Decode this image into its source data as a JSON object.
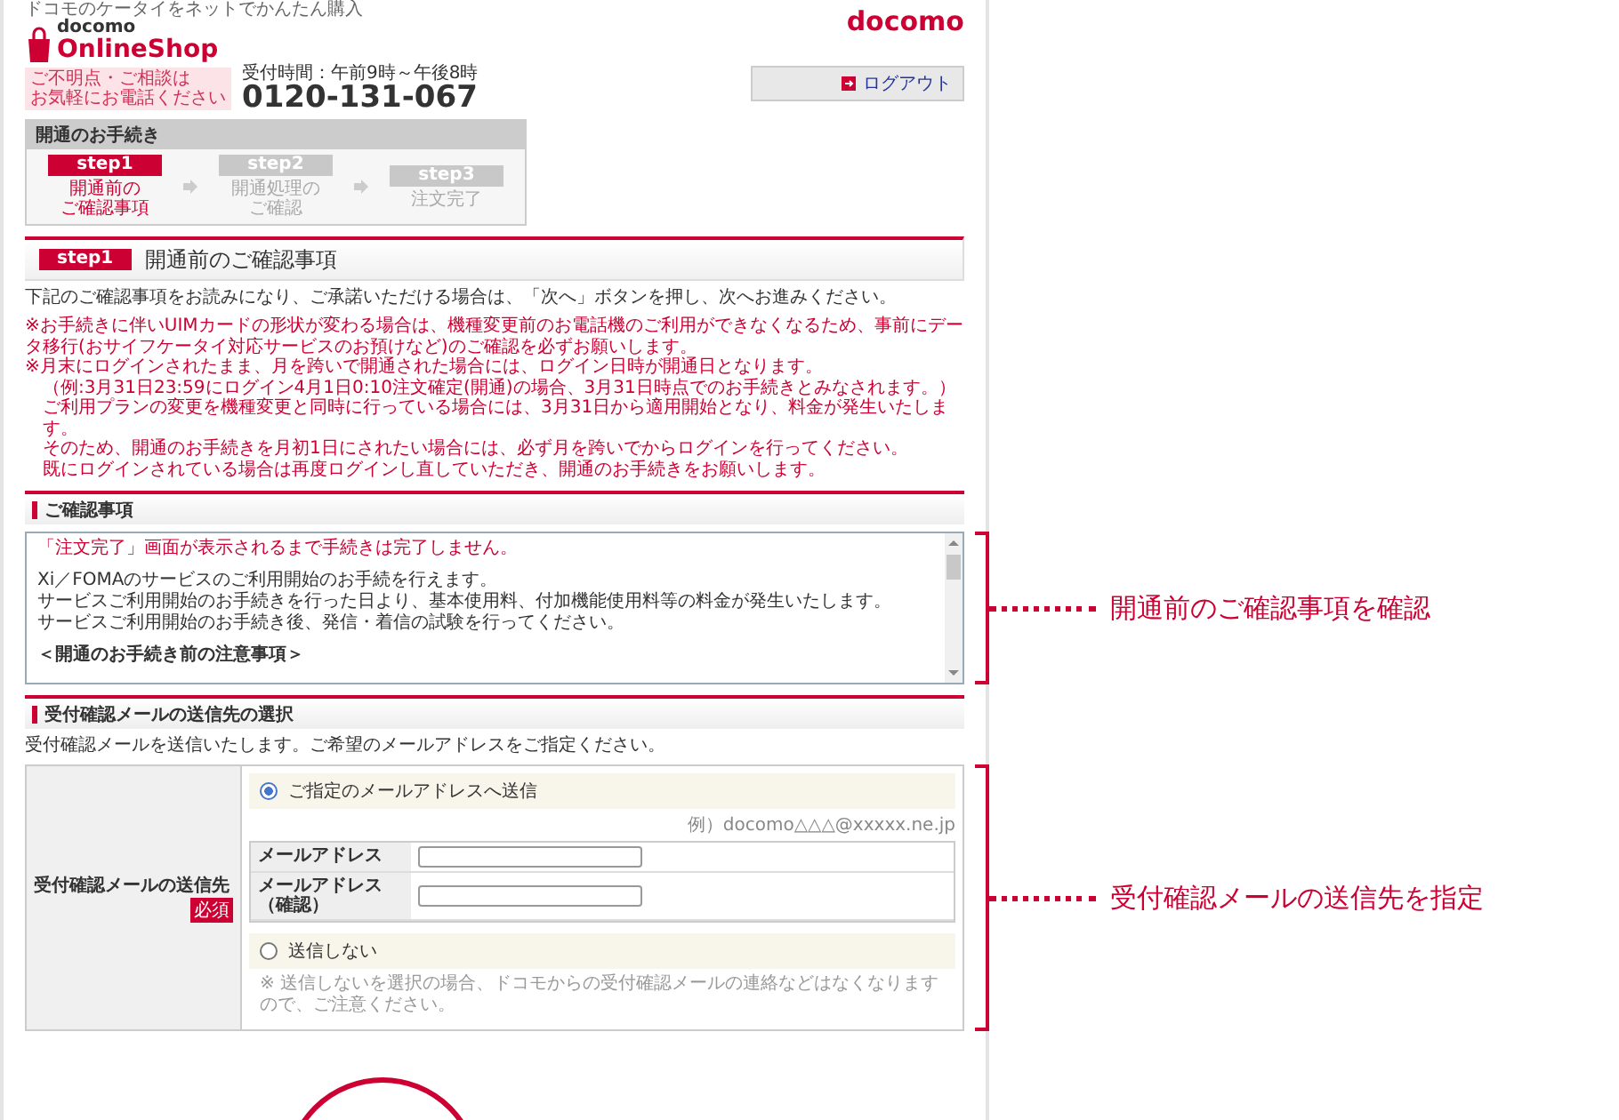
{
  "header": {
    "tagline": "ドコモのケータイをネットでかんたん購入",
    "logo_small": "docomo",
    "logo_text": "OnlineShop",
    "brand": "docomo"
  },
  "contact": {
    "notice": [
      "ご不明点・ご相談は",
      "お気軽にお電話ください"
    ],
    "hours": "受付時間：午前9時～午後8時",
    "phone": "0120-131-067"
  },
  "logout_button": "ログアウト",
  "steps_panel": {
    "title": "開通のお手続き",
    "steps": [
      {
        "label": "step1",
        "text": [
          "開通前の",
          "ご確認事項"
        ],
        "current": true
      },
      {
        "label": "step2",
        "text": [
          "開通処理の",
          "ご確認"
        ],
        "current": false
      },
      {
        "label": "step3",
        "text": [
          "注文完了"
        ],
        "current": false
      }
    ]
  },
  "page_heading": {
    "badge": "step1",
    "title": "開通前のご確認事項"
  },
  "intro": "下記のご確認事項をお読みになり、ご承諾いただける場合は、「次へ」ボタンを押し、次へお進みください。",
  "notes": [
    {
      "kind": "main",
      "text": "※お手続きに伴いUIMカードの形状が変わる場合は、機種変更前のお電話機のご利用ができなくなるため、事前にデータ移行(おサイフケータイ対応サービスのお預けなど)のご確認を必ずお願いします。"
    },
    {
      "kind": "main",
      "text": "※月末にログインされたまま、月を跨いで開通された場合には、ログイン日時が開通日となります。"
    },
    {
      "kind": "sub",
      "text": "（例:3月31日23:59にログイン4月1日0:10注文確定(開通)の場合、3月31日時点でのお手続きとみなされます。）"
    },
    {
      "kind": "sub",
      "text": "ご利用プランの変更を機種変更と同時に行っている場合には、3月31日から適用開始となり、料金が発生いたします。"
    },
    {
      "kind": "sub",
      "text": "そのため、開通のお手続きを月初1日にされたい場合には、必ず月を跨いでからログインを行ってください。"
    },
    {
      "kind": "sub",
      "text": "既にログインされている場合は再度ログインし直していただき、開通のお手続きをお願いします。"
    }
  ],
  "confirm_section": {
    "title": "ご確認事項",
    "box_lines": [
      {
        "kind": "alert",
        "text": "「注文完了」画面が表示されるまで手続きは完了しません。"
      },
      {
        "kind": "body",
        "text": "Xi／FOMAのサービスのご利用開始のお手続を行えます。"
      },
      {
        "kind": "body",
        "text": "サービスご利用開始のお手続きを行った日より、基本使用料、付加機能使用料等の料金が発生いたします。"
      },
      {
        "kind": "body",
        "text": "サービスご利用開始のお手続き後、発信・着信の試験を行ってください。"
      },
      {
        "kind": "heading",
        "text": "＜開通のお手続き前の注意事項＞"
      }
    ]
  },
  "mail_section": {
    "title": "受付確認メールの送信先の選択",
    "intro": "受付確認メールを送信いたします。ご希望のメールアドレスをご指定ください。",
    "row_label": "受付確認メールの送信先",
    "required_badge": "必須",
    "options": [
      {
        "label": "ご指定のメールアドレスへ送信",
        "selected": true
      },
      {
        "label": "送信しない",
        "selected": false,
        "note": "※ 送信しないを選択の場合、ドコモからの受付確認メールの連絡などはなくなりますので、ご注意ください。"
      }
    ],
    "example": "例）docomo△△△@xxxxx.ne.jp",
    "fields": [
      {
        "label": [
          "メールアドレス"
        ]
      },
      {
        "label": [
          "メールアドレス",
          "（確認）"
        ]
      }
    ]
  },
  "annotations": [
    {
      "text": "開通前のご確認事項を確認"
    },
    {
      "text": "受付確認メールの送信先を指定"
    }
  ]
}
